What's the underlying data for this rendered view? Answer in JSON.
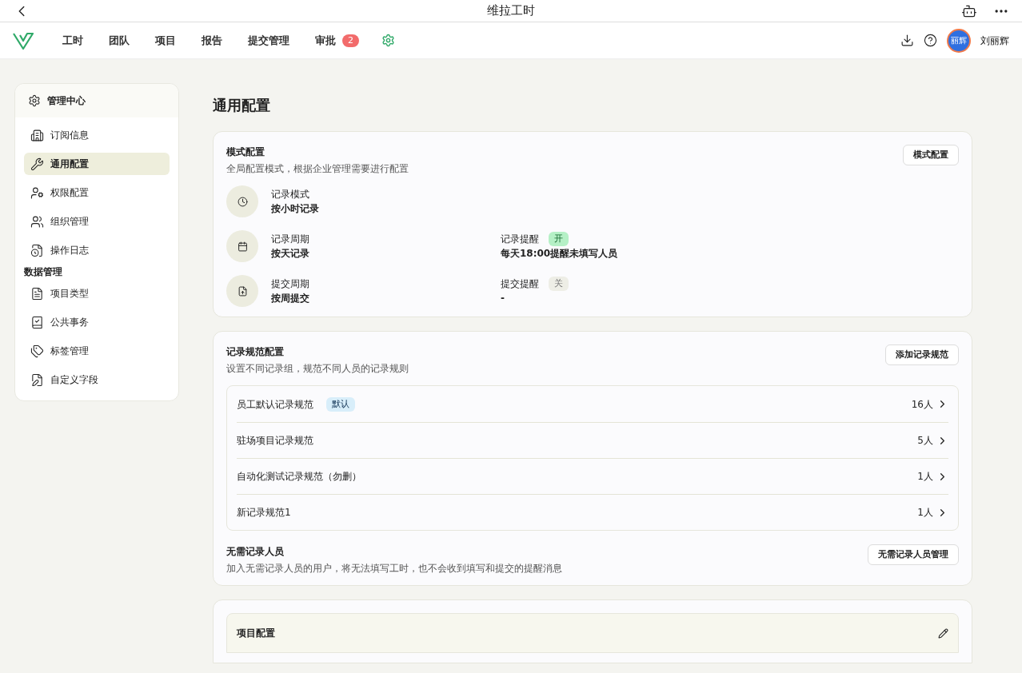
{
  "window": {
    "title": "维拉工时"
  },
  "nav": {
    "items": [
      {
        "label": "工时",
        "selected": false
      },
      {
        "label": "团队",
        "selected": false
      },
      {
        "label": "项目",
        "selected": false
      },
      {
        "label": "报告",
        "selected": false
      },
      {
        "label": "提交管理",
        "selected": false
      },
      {
        "label": "审批",
        "selected": false,
        "badge": "2"
      }
    ],
    "settings_selected": true,
    "user": {
      "avatar_text": "丽辉",
      "name": "刘丽辉"
    }
  },
  "sidebar": {
    "title": "管理中心",
    "items": [
      {
        "kind": "item",
        "label": "订阅信息",
        "selected": false
      },
      {
        "kind": "item",
        "label": "通用配置",
        "selected": true
      },
      {
        "kind": "item",
        "label": "权限配置",
        "selected": false
      },
      {
        "kind": "item",
        "label": "组织管理",
        "selected": false
      },
      {
        "kind": "item",
        "label": "操作日志",
        "selected": false
      },
      {
        "kind": "heading",
        "label": "数据管理"
      },
      {
        "kind": "item",
        "label": "项目类型",
        "selected": false
      },
      {
        "kind": "item",
        "label": "公共事务",
        "selected": false
      },
      {
        "kind": "item",
        "label": "标签管理",
        "selected": false
      },
      {
        "kind": "item",
        "label": "自定义字段",
        "selected": false
      }
    ]
  },
  "page_title": "通用配置",
  "mode_config": {
    "title": "模式配置",
    "description": "全局配置模式，根据企业管理需要进行配置",
    "button": "模式配置",
    "rows": [
      {
        "label": "记录模式",
        "value": "按小时记录"
      },
      {
        "label": "记录周期",
        "value": "按天记录",
        "reminder": {
          "label": "记录提醒",
          "toggle": "开",
          "on": true,
          "value": "每天18:00提醒未填写人员"
        }
      },
      {
        "label": "提交周期",
        "value": "按周提交",
        "reminder": {
          "label": "提交提醒",
          "toggle": "关",
          "on": false,
          "value": "-"
        }
      }
    ]
  },
  "record_rules": {
    "title": "记录规范配置",
    "description": "设置不同记录组，规范不同人员的记录规则",
    "button": "添加记录规范",
    "rules": [
      {
        "name": "员工默认记录规范",
        "tag": "默认",
        "count": "16人"
      },
      {
        "name": "驻场项目记录规范",
        "count": "5人"
      },
      {
        "name": "自动化测试记录规范（勿删）",
        "count": "1人"
      },
      {
        "name": "新记录规范1",
        "count": "1人"
      }
    ],
    "exempt": {
      "title": "无需记录人员",
      "description": "加入无需记录人员的用户，将无法填写工时，也不会收到填写和提交的提醒消息",
      "button": "无需记录人员管理"
    }
  },
  "project_config": {
    "title": "项目配置"
  }
}
